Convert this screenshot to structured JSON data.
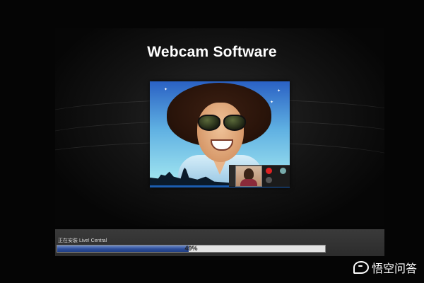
{
  "installer": {
    "title": "Webcam Software",
    "status_text": "正在安装 Live! Central",
    "progress_percent": 49,
    "progress_label": "49%"
  },
  "preview": {
    "icons": [
      "glasses-portrait-icon",
      "statue-of-liberty-icon",
      "video-call-thumbnail-icon"
    ]
  },
  "watermark": {
    "text": "悟空问答"
  },
  "colors": {
    "background": "#050505",
    "panel": "#2c2c2c",
    "progress_fill": "#2c4d9a",
    "progress_track": "#e3e3e3"
  }
}
